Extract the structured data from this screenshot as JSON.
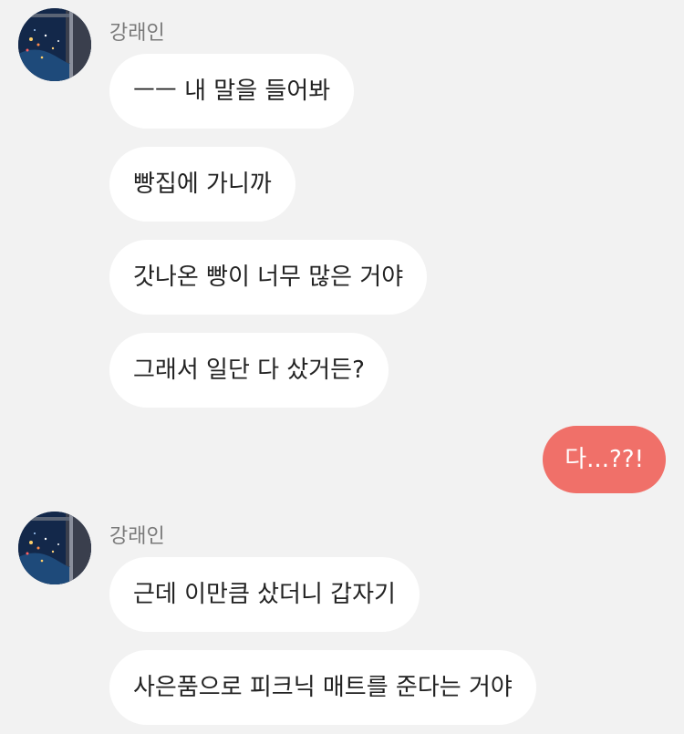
{
  "groups": [
    {
      "sender": "강래인",
      "avatar_icon": "night-window-avatar",
      "messages": [
        "ㅡㅡ 내 말을 들어봐",
        "빵집에 가니까",
        "갓나온 빵이 너무 많은 거야",
        "그래서 일단 다 샀거든?"
      ]
    },
    {
      "mine": true,
      "messages": [
        "다...??!"
      ]
    },
    {
      "sender": "강래인",
      "avatar_icon": "night-window-avatar",
      "messages": [
        "근데 이만큼 샀더니 갑자기",
        "사은품으로 피크닉 매트를 준다는 거야"
      ]
    }
  ],
  "colors": {
    "background": "#f2f2f2",
    "incoming_bubble": "#ffffff",
    "outgoing_bubble": "#f07069",
    "sender_name": "#7a7a7a"
  }
}
